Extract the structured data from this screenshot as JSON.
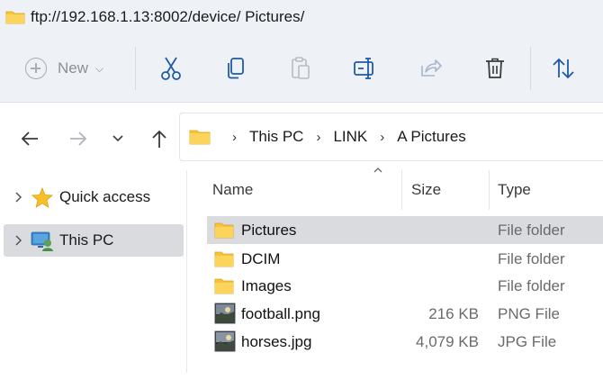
{
  "window": {
    "title": "ftp://192.168.1.13:8002/device/ Pictures/"
  },
  "toolbar": {
    "new_label": "New",
    "buttons": [
      "cut-icon",
      "copy-icon",
      "paste-icon",
      "rename-icon",
      "share-icon",
      "delete-icon",
      "sort-icon"
    ]
  },
  "address": {
    "crumbs": [
      "This PC",
      "LINK",
      "A Pictures"
    ]
  },
  "sidebar": {
    "items": [
      {
        "label": "Quick access",
        "icon": "star-icon"
      },
      {
        "label": "This PC",
        "icon": "this-pc-icon",
        "active": true
      }
    ]
  },
  "columns": {
    "name": "Name",
    "size": "Size",
    "type": "Type"
  },
  "files": [
    {
      "name": "Pictures",
      "size": "",
      "type": "File folder",
      "icon": "folder-icon"
    },
    {
      "name": "DCIM",
      "size": "",
      "type": "File folder",
      "icon": "folder-icon"
    },
    {
      "name": "Images",
      "size": "",
      "type": "File folder",
      "icon": "folder-icon"
    },
    {
      "name": "football.png",
      "size": "216 KB",
      "type": "PNG File",
      "icon": "image-file-icon"
    },
    {
      "name": "horses.jpg",
      "size": "4,079 KB",
      "type": "JPG File",
      "icon": "image-file-icon"
    }
  ],
  "colors": {
    "accent": "#0067c0",
    "folder": "#f8c33a",
    "selection": "#d9dbde",
    "chrome": "#eef2f7"
  }
}
